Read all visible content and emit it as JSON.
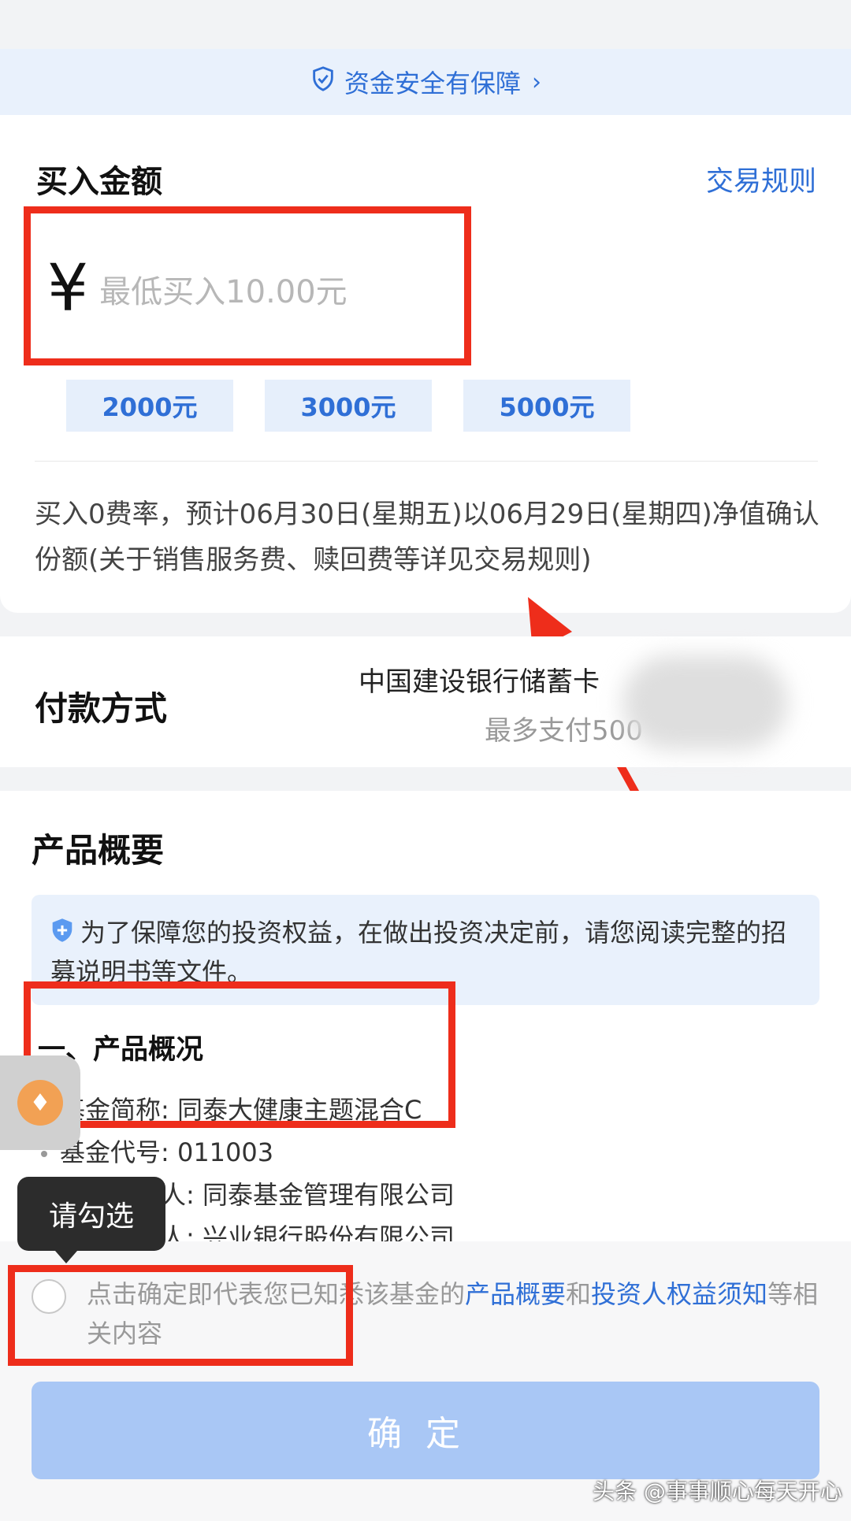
{
  "banner": {
    "text": "资金安全有保障",
    "chevron": "›",
    "icon": "shield-check-icon"
  },
  "buy": {
    "title": "买入金额",
    "rules_link": "交易规则",
    "currency_symbol": "¥",
    "placeholder": "最低买入10.00元",
    "quick_amounts": [
      "2000元",
      "3000元",
      "5000元"
    ],
    "fee_note": "买入0费率，预计06月30日(星期五)以06月29日(星期四)净值确认份额(关于销售服务费、赎回费等详见交易规则)"
  },
  "payment": {
    "label": "付款方式",
    "bank": "中国建设银行储蓄卡",
    "limit": "最多支付500"
  },
  "product": {
    "title": "产品概要",
    "notice": "为了保障您的投资权益，在做出投资决定前，请您阅读完整的招募说明书等文件。",
    "section_title": "一、产品概况",
    "details": [
      "基金简称: 同泰大健康主题混合C",
      "基金代号: 011003",
      "基金管理人: 同泰基金管理有限公司",
      "基金托管人: 兴业银行股份有限公司"
    ]
  },
  "tooltip": "请勾选",
  "agreement": {
    "prefix": "点击确定即代表您已知悉该基金的",
    "link1": "产品概要",
    "mid": "和",
    "link2": "投资人权益须知",
    "suffix": "等相关内容"
  },
  "confirm_label": "确定",
  "watermark": "头条 @事事顺心每天开心",
  "colors": {
    "accent": "#2f6fd6",
    "annotation": "#ee2d1b",
    "confirm_disabled": "#a9c7f5"
  }
}
